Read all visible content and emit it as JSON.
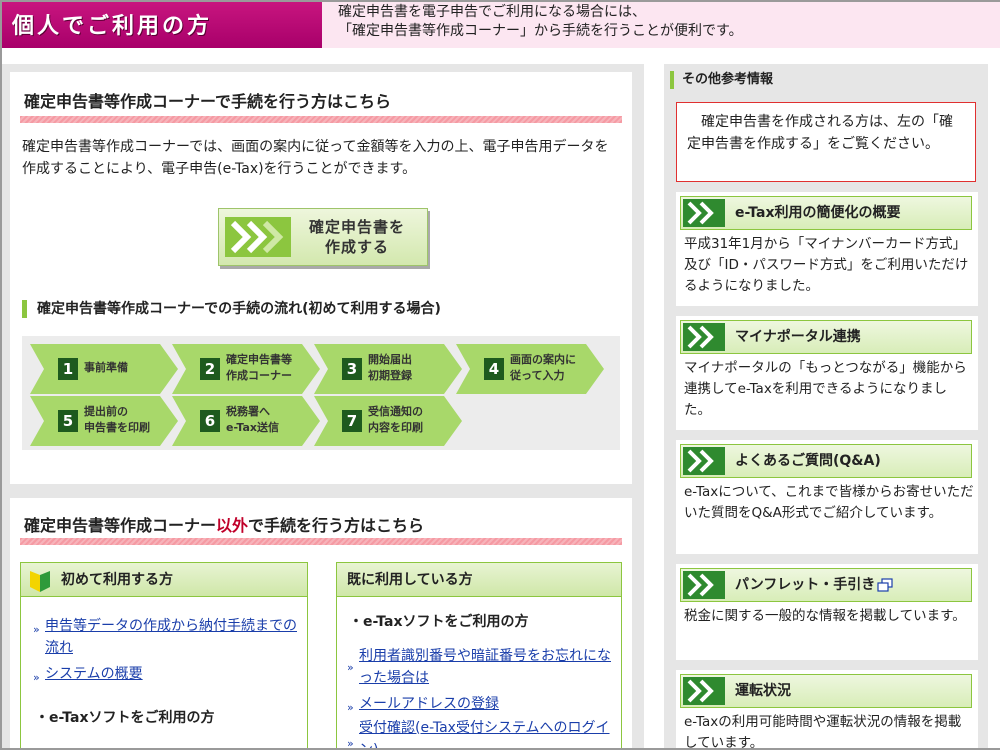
{
  "header": {
    "title": "個人でご利用の方",
    "desc_line1": "確定申告書を電子申告でご利用になる場合には、",
    "desc_line2": "「確定申告書等作成コーナー」から手続を行うことが便利です。"
  },
  "section1": {
    "title": "確定申告書等作成コーナーで手続を行う方はこちら",
    "body": "確定申告書等作成コーナーでは、画面の案内に従って金額等を入力の上、電子申告用データを作成することにより、電子申告(e-Tax)を行うことができます。",
    "button_line1": "確定申告書を",
    "button_line2": "作成する",
    "flow_title": "確定申告書等作成コーナーでの手続の流れ(初めて利用する場合)",
    "steps": [
      {
        "num": "1",
        "line1": "事前準備",
        "line2": ""
      },
      {
        "num": "2",
        "line1": "確定申告書等",
        "line2": "作成コーナー"
      },
      {
        "num": "3",
        "line1": "開始届出",
        "line2": "初期登録"
      },
      {
        "num": "4",
        "line1": "画面の案内に",
        "line2": "従って入力"
      },
      {
        "num": "5",
        "line1": "提出前の",
        "line2": "申告書を印刷"
      },
      {
        "num": "6",
        "line1": "税務署へ",
        "line2": "e-Tax送信"
      },
      {
        "num": "7",
        "line1": "受信通知の",
        "line2": "内容を印刷"
      }
    ]
  },
  "section2": {
    "title_pre": "確定申告書等作成コーナー",
    "title_em": "以外",
    "title_post": "で手続を行う方はこちら",
    "accent_color": "#c0002a",
    "box_first": {
      "title": "初めて利用する方",
      "links": [
        "申告等データの作成から納付手続までの流れ",
        "システムの概要"
      ],
      "subhead": "・e-Taxソフトをご利用の方"
    },
    "box_existing": {
      "title": "既に利用している方",
      "subhead": "・e-Taxソフトをご利用の方",
      "links": [
        "利用者識別番号や暗証番号をお忘れになった場合は",
        "メールアドレスの登録",
        "受付確認(e-Tax受付システムへのログイン)"
      ]
    }
  },
  "sidebar": {
    "title": "その他参考情報",
    "note": "　確定申告書を作成される方は、左の「確定申告書を作成する」をご覧ください。",
    "cards": [
      {
        "title": "e-Tax利用の簡便化の概要",
        "body": "平成31年1月から「マイナンバーカード方式」及び「ID・パスワード方式」をご利用いただけるようになりました。"
      },
      {
        "title": "マイナポータル連携",
        "body": "マイナポータルの「もっとつながる」機能から連携してe-Taxを利用できるようになりました。"
      },
      {
        "title": "よくあるご質問(Q&A)",
        "body": "e-Taxについて、これまで皆様からお寄せいただいた質問をQ&A形式でご紹介しています。"
      },
      {
        "title": "パンフレット・手引き",
        "body": "税金に関する一般的な情報を掲載しています。"
      },
      {
        "title": "運転状況",
        "body": "e-Taxの利用可能時間や運転状況の情報を掲載しています。"
      }
    ]
  },
  "colors": {
    "brand_magenta": "#b8007a",
    "green_accent": "#8cc63f",
    "dark_green": "#1e5a1e",
    "link_blue": "#1a3eaa"
  }
}
